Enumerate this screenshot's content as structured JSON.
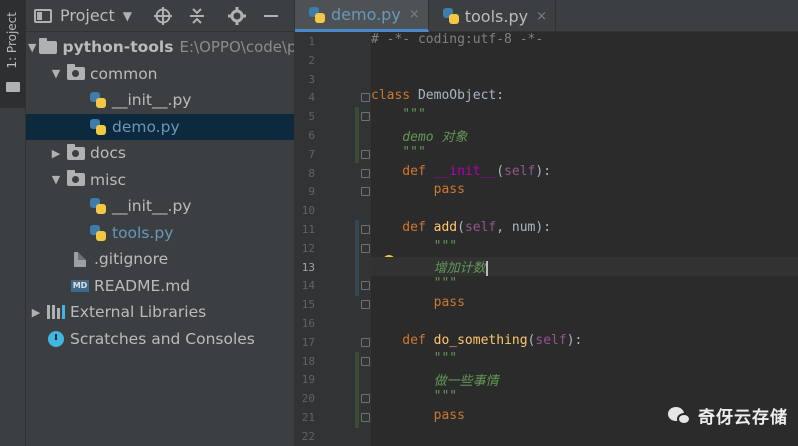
{
  "tool_strip": {
    "project_tab_label": "1: Project"
  },
  "project_panel": {
    "title": "Project",
    "tree": [
      {
        "label": "python-tools",
        "path": "E:\\OPPO\\code\\p"
      },
      {
        "label": "common"
      },
      {
        "label": "__init__.py"
      },
      {
        "label": "demo.py"
      },
      {
        "label": "docs"
      },
      {
        "label": "misc"
      },
      {
        "label": "__init__.py"
      },
      {
        "label": "tools.py"
      },
      {
        "label": ".gitignore"
      },
      {
        "label": "README.md",
        "badge": "MD"
      },
      {
        "label": "External Libraries"
      },
      {
        "label": "Scratches and Consoles"
      }
    ]
  },
  "editor": {
    "tabs": [
      {
        "label": "demo.py",
        "close": "×"
      },
      {
        "label": "tools.py",
        "close": "×"
      }
    ],
    "line_numbers": [
      "1",
      "2",
      "3",
      "4",
      "5",
      "6",
      "7",
      "8",
      "9",
      "10",
      "11",
      "12",
      "13",
      "14",
      "15",
      "16",
      "17",
      "18",
      "19",
      "20",
      "21",
      "22"
    ],
    "current_line": 13,
    "code": {
      "l1": "# -*- coding:utf-8 -*-",
      "l4_kw": "class",
      "l4_name": " DemoObject:",
      "l5": "    \"\"\"",
      "l6": "    demo 对象",
      "l7": "    \"\"\"",
      "l8_kw": "    def",
      "l8_fn": "__init__",
      "l8_open": "(",
      "l8_self": "self",
      "l8_close": "):",
      "l9_kw": "        pass",
      "l11_kw": "    def",
      "l11_fn": "add",
      "l11_open": "(",
      "l11_self": "self",
      "l11_rest": ", num):",
      "l12": "        \"\"\"",
      "l13": "        增加计数",
      "l14": "        \"\"\"",
      "l15_kw": "        pass",
      "l17_kw": "    def",
      "l17_fn": "do_something",
      "l17_open": "(",
      "l17_self": "self",
      "l17_close": "):",
      "l18": "        \"\"\"",
      "l19": "        做一些事情",
      "l20": "        \"\"\"",
      "l21_kw": "        pass"
    }
  },
  "watermark": {
    "text": "奇伢云存储"
  },
  "colors": {
    "editor_bg": "#2B2B2B",
    "panel_bg": "#3C3F41",
    "keyword": "#CC7832",
    "function": "#FFC66D",
    "docstring": "#629755",
    "comment": "#808080",
    "self": "#94558D",
    "magic": "#B200B2",
    "selection": "#0D293E",
    "active_tab_text": "#6897BB"
  }
}
